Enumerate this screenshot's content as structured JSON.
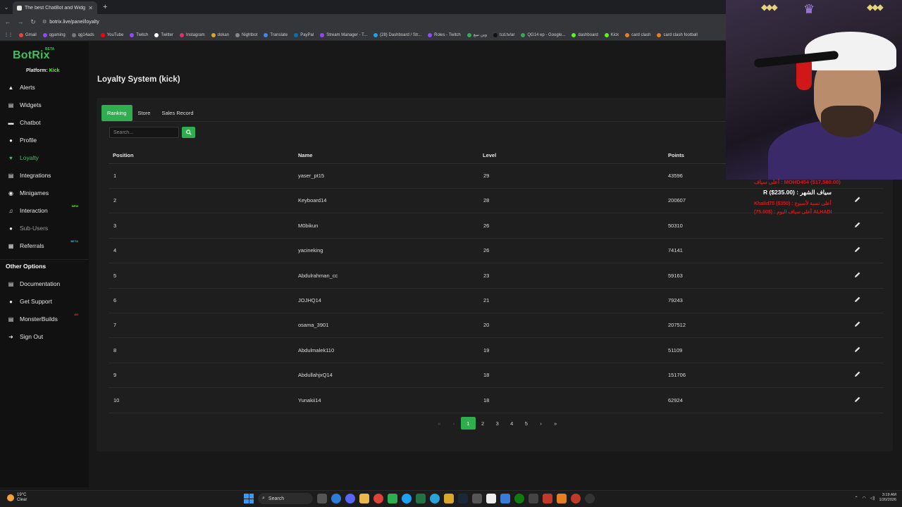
{
  "browser": {
    "tab_title": "The best ChatBot and Widgets",
    "url": "botrix.live/panel/loyalty",
    "bookmarks": [
      "Gmail",
      "qgaming",
      "qg14ads",
      "YouTube",
      "Twitch",
      "Twitter",
      "Instagram",
      "dokan",
      "Nightbot",
      "Translate",
      "PayPal",
      "Stream Manager - T...",
      "(28) Dashboard / Str...",
      "Roles - Twitch",
      "وين نبيع",
      "tcd.tv/ar",
      "QG14 ep - Google...",
      "dashboard",
      "Kick",
      "card clash",
      "card clash football"
    ]
  },
  "sidebar": {
    "logo": "BotRix",
    "logo_badge": "BETA",
    "platform_label": "Platform:",
    "platform_value": "Kick",
    "items": [
      {
        "label": "Alerts",
        "icon": "warning-icon"
      },
      {
        "label": "Widgets",
        "icon": "widgets-icon"
      },
      {
        "label": "Chatbot",
        "icon": "chat-icon"
      },
      {
        "label": "Profile",
        "icon": "profile-icon"
      },
      {
        "label": "Loyalty",
        "icon": "heart-icon",
        "active": true
      },
      {
        "label": "Integrations",
        "icon": "integrations-icon"
      },
      {
        "label": "Minigames",
        "icon": "gamepad-icon"
      },
      {
        "label": "Interaction",
        "icon": "music-icon",
        "badge": "NEW"
      },
      {
        "label": "Sub-Users",
        "icon": "users-icon",
        "muted": true
      },
      {
        "label": "Referrals",
        "icon": "referrals-icon",
        "badge": "BETA"
      }
    ],
    "other_heading": "Other Options",
    "other_items": [
      {
        "label": "Documentation",
        "icon": "book-icon"
      },
      {
        "label": "Get Support",
        "icon": "help-icon"
      },
      {
        "label": "MonsterBuilds",
        "icon": "server-icon",
        "badge": "AD"
      },
      {
        "label": "Sign Out",
        "icon": "signout-icon"
      }
    ]
  },
  "page": {
    "title": "Loyalty System (kick)",
    "tabs": [
      "Ranking",
      "Store",
      "Sales Record"
    ],
    "active_tab": "Ranking",
    "search_placeholder": "Search...",
    "columns": [
      "Position",
      "Name",
      "Level",
      "Points"
    ],
    "rows": [
      {
        "position": "1",
        "name": "yaser_pt15",
        "level": "29",
        "points": "43596"
      },
      {
        "position": "2",
        "name": "Keyboard14",
        "level": "28",
        "points": "200607"
      },
      {
        "position": "3",
        "name": "M0bikun",
        "level": "26",
        "points": "50310"
      },
      {
        "position": "4",
        "name": "yacineking",
        "level": "26",
        "points": "74141"
      },
      {
        "position": "5",
        "name": "Abdulrahman_cc",
        "level": "23",
        "points": "59163"
      },
      {
        "position": "6",
        "name": "JOJHQ14",
        "level": "21",
        "points": "79243"
      },
      {
        "position": "7",
        "name": "osama_3901",
        "level": "20",
        "points": "207512"
      },
      {
        "position": "8",
        "name": "Abdulmalek110",
        "level": "19",
        "points": "51109"
      },
      {
        "position": "9",
        "name": "AbdullahjxQ14",
        "level": "18",
        "points": "151706"
      },
      {
        "position": "10",
        "name": "Yunakii14",
        "level": "18",
        "points": "62924"
      }
    ],
    "pagination": {
      "first": "«",
      "prev": "‹",
      "pages": [
        "1",
        "2",
        "3",
        "4",
        "5"
      ],
      "current": "1",
      "next": "›",
      "last": "»"
    }
  },
  "overlay": {
    "line1": "أعلى سياف : MOHD454 ($17,580.00)",
    "line2": "R ($235.00) : سياف الشهر",
    "line3": "Khalid75 ($350) : أعلى نسبة لأسبوع",
    "line4": "أعلى سياف اليوم : ($75.00) ALHADI"
  },
  "taskbar": {
    "temp": "19°C",
    "weather": "Clear",
    "search": "Search",
    "time": "3:19 AM",
    "date": "1/20/2026"
  },
  "colors": {
    "accent": "#2eae4f",
    "kick": "#53fc18",
    "bg": "#181818",
    "sidebar": "#111111"
  }
}
